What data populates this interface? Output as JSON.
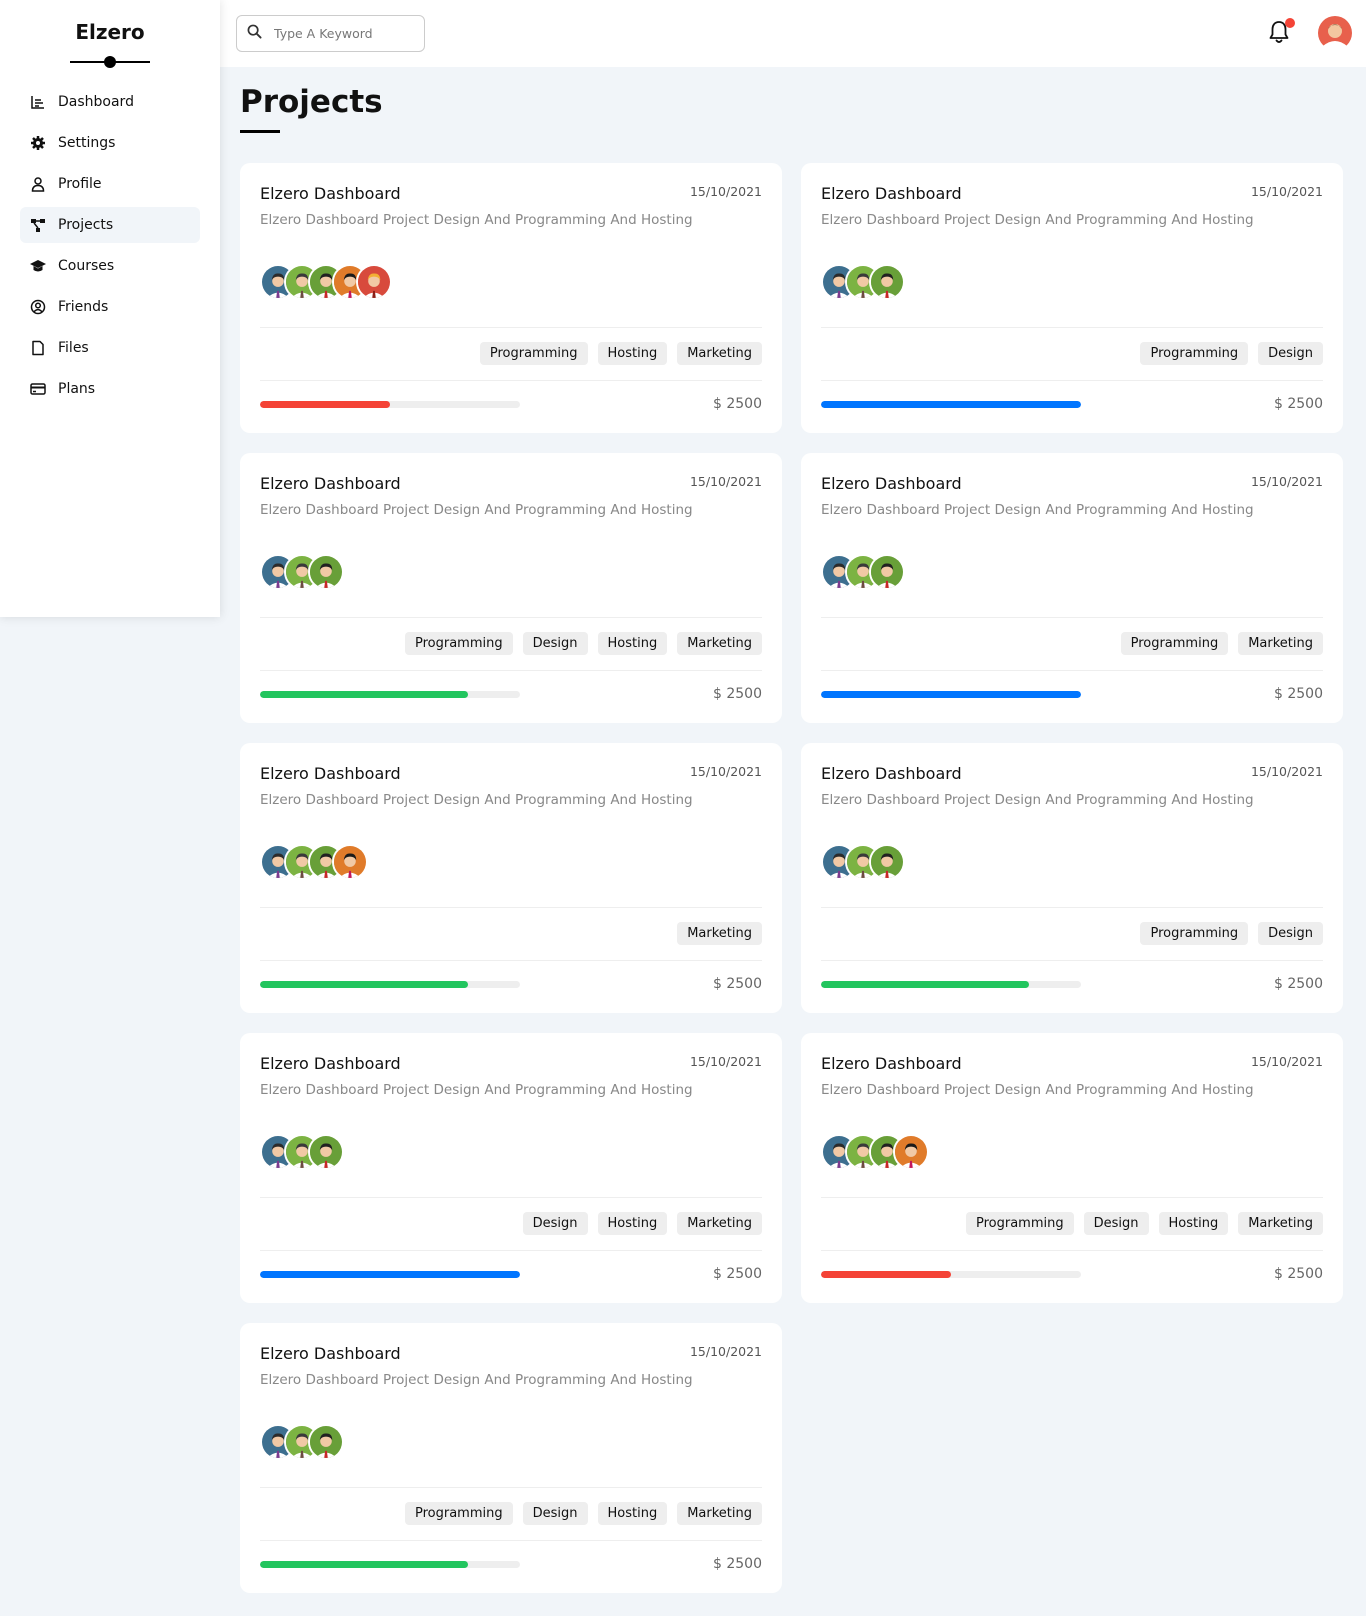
{
  "sidebar": {
    "brand": "Elzero",
    "items": [
      {
        "label": "Dashboard",
        "icon": "chart-icon",
        "active": false
      },
      {
        "label": "Settings",
        "icon": "gear-icon",
        "active": false
      },
      {
        "label": "Profile",
        "icon": "user-icon",
        "active": false
      },
      {
        "label": "Projects",
        "icon": "diagram-icon",
        "active": true
      },
      {
        "label": "Courses",
        "icon": "graduation-cap-icon",
        "active": false
      },
      {
        "label": "Friends",
        "icon": "user-circle-icon",
        "active": false
      },
      {
        "label": "Files",
        "icon": "file-icon",
        "active": false
      },
      {
        "label": "Plans",
        "icon": "credit-card-icon",
        "active": false
      }
    ]
  },
  "topbar": {
    "search_placeholder": "Type A Keyword"
  },
  "page": {
    "title": "Projects"
  },
  "colors": {
    "red": "#f44336",
    "blue": "#0075ff",
    "green": "#22c55e"
  },
  "projects": [
    {
      "title": "Elzero Dashboard",
      "date": "15/10/2021",
      "desc": "Elzero Dashboard Project Design And Programming And Hosting",
      "team": 5,
      "tags": [
        "Programming",
        "Hosting",
        "Marketing"
      ],
      "progress": 0.5,
      "color": "red",
      "price": "$ 2500"
    },
    {
      "title": "Elzero Dashboard",
      "date": "15/10/2021",
      "desc": "Elzero Dashboard Project Design And Programming And Hosting",
      "team": 3,
      "tags": [
        "Programming",
        "Design"
      ],
      "progress": 1.0,
      "color": "blue",
      "price": "$ 2500"
    },
    {
      "title": "Elzero Dashboard",
      "date": "15/10/2021",
      "desc": "Elzero Dashboard Project Design And Programming And Hosting",
      "team": 3,
      "tags": [
        "Programming",
        "Design",
        "Hosting",
        "Marketing"
      ],
      "progress": 0.8,
      "color": "green",
      "price": "$ 2500"
    },
    {
      "title": "Elzero Dashboard",
      "date": "15/10/2021",
      "desc": "Elzero Dashboard Project Design And Programming And Hosting",
      "team": 3,
      "tags": [
        "Programming",
        "Marketing"
      ],
      "progress": 1.0,
      "color": "blue",
      "price": "$ 2500"
    },
    {
      "title": "Elzero Dashboard",
      "date": "15/10/2021",
      "desc": "Elzero Dashboard Project Design And Programming And Hosting",
      "team": 4,
      "tags": [
        "Marketing"
      ],
      "progress": 0.8,
      "color": "green",
      "price": "$ 2500"
    },
    {
      "title": "Elzero Dashboard",
      "date": "15/10/2021",
      "desc": "Elzero Dashboard Project Design And Programming And Hosting",
      "team": 3,
      "tags": [
        "Programming",
        "Design"
      ],
      "progress": 0.8,
      "color": "green",
      "price": "$ 2500"
    },
    {
      "title": "Elzero Dashboard",
      "date": "15/10/2021",
      "desc": "Elzero Dashboard Project Design And Programming And Hosting",
      "team": 3,
      "tags": [
        "Design",
        "Hosting",
        "Marketing"
      ],
      "progress": 1.0,
      "color": "blue",
      "price": "$ 2500"
    },
    {
      "title": "Elzero Dashboard",
      "date": "15/10/2021",
      "desc": "Elzero Dashboard Project Design And Programming And Hosting",
      "team": 4,
      "tags": [
        "Programming",
        "Design",
        "Hosting",
        "Marketing"
      ],
      "progress": 0.5,
      "color": "red",
      "price": "$ 2500"
    },
    {
      "title": "Elzero Dashboard",
      "date": "15/10/2021",
      "desc": "Elzero Dashboard Project Design And Programming And Hosting",
      "team": 3,
      "tags": [
        "Programming",
        "Design",
        "Hosting",
        "Marketing"
      ],
      "progress": 0.8,
      "color": "green",
      "price": "$ 2500"
    }
  ]
}
